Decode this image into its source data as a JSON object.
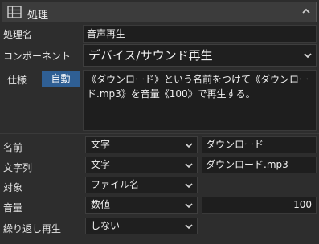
{
  "header": {
    "title": "処理",
    "icon": "table-icon",
    "collapse_icon": "chevron-up-icon"
  },
  "rows": {
    "name_label": "処理名",
    "name_value": "音声再生",
    "component_label": "コンポーネント",
    "component_value": "デバイス/サウンド再生",
    "spec_label": "仕様",
    "auto_label": "自動",
    "spec_text": "《ダウンロード》という名前をつけて《ダウンロード.mp3》を音量《100》で再生する。"
  },
  "params": [
    {
      "label": "名前",
      "type": "文字",
      "value": "ダウンロード"
    },
    {
      "label": "文字列",
      "type": "文字",
      "value": "ダウンロード.mp3"
    },
    {
      "label": "対象",
      "type": "ファイル名",
      "value": ""
    },
    {
      "label": "音量",
      "type": "数値",
      "value": "100"
    },
    {
      "label": "繰り返し再生",
      "type": "しない",
      "value": ""
    }
  ]
}
